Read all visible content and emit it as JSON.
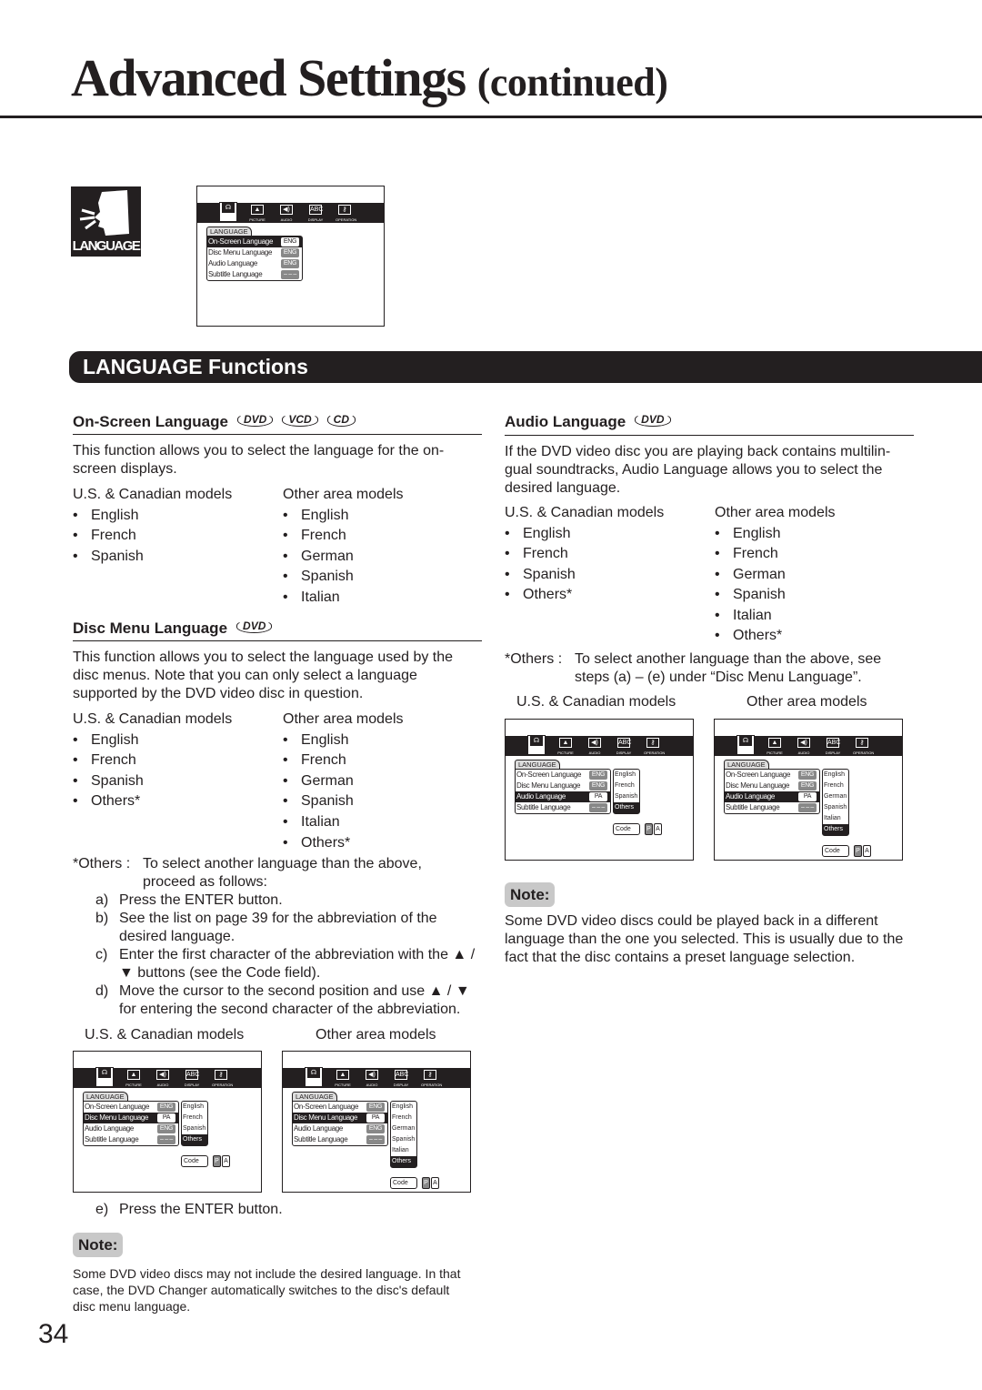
{
  "header": {
    "title": "Advanced Settings",
    "title_suffix": "(continued)"
  },
  "language_icon": {
    "label": "LANGUAGE",
    "icon": "speaking-head-icon"
  },
  "banner": "LANGUAGE Functions",
  "page_number": "34",
  "menu": {
    "icons": [
      {
        "name": "language-icon",
        "label": ""
      },
      {
        "name": "picture-icon",
        "label": "PICTURE"
      },
      {
        "name": "audio-icon",
        "label": "AUDIO"
      },
      {
        "name": "display-icon",
        "label": "DISPLAY"
      },
      {
        "name": "operation-icon",
        "label": "OPERATION"
      }
    ],
    "tab": "LANGUAGE",
    "rows": [
      "On-Screen Language",
      "Disc Menu Language",
      "Audio Language",
      "Subtitle Language"
    ],
    "code_label": "Code",
    "code_chars": [
      "P",
      "A"
    ]
  },
  "mockups": {
    "top": {
      "selected": 0,
      "values": [
        "ENG",
        "ENG",
        "ENG",
        "– – –"
      ],
      "options": []
    },
    "disc_us": {
      "selected": 1,
      "values": [
        "ENG",
        "PA",
        "ENG",
        "– – –"
      ],
      "options": [
        "English",
        "French",
        "Spanish",
        "Others"
      ],
      "option_selected": 3
    },
    "disc_other": {
      "selected": 1,
      "values": [
        "ENG",
        "PA",
        "ENG",
        "– – –"
      ],
      "options": [
        "English",
        "French",
        "German",
        "Spanish",
        "Italian",
        "Others"
      ],
      "option_selected": 5
    },
    "audio_us": {
      "selected": 2,
      "values": [
        "ENG",
        "ENG",
        "PA",
        "– – –"
      ],
      "options": [
        "English",
        "French",
        "Spanish",
        "Others"
      ],
      "option_selected": 3
    },
    "audio_other": {
      "selected": 2,
      "values": [
        "ENG",
        "ENG",
        "PA",
        "– – –"
      ],
      "options": [
        "English",
        "French",
        "German",
        "Spanish",
        "Italian",
        "Others"
      ],
      "option_selected": 5
    }
  },
  "onscreen": {
    "heading": "On-Screen Language",
    "badges": [
      "DVD",
      "VCD",
      "CD"
    ],
    "para": [
      "This function allows you to select the language for the on-",
      "screen displays."
    ],
    "us_label": "U.S. & Canadian models",
    "other_label": "Other area models",
    "us": [
      "English",
      "French",
      "Spanish"
    ],
    "other": [
      "English",
      "French",
      "German",
      "Spanish",
      "Italian"
    ]
  },
  "discmenu": {
    "heading": "Disc Menu Language",
    "badges": [
      "DVD"
    ],
    "para": [
      "This function allows you to select the language used by the",
      "disc menus. Note that you can only select a language",
      "supported by the DVD video disc in question."
    ],
    "us_label": "U.S. & Canadian models",
    "other_label": "Other area models",
    "us": [
      "English",
      "French",
      "Spanish",
      "Others*"
    ],
    "other": [
      "English",
      "French",
      "German",
      "Spanish",
      "Italian",
      "Others*"
    ],
    "others_key": "*Others :",
    "others_text": [
      "To select another language than the above,",
      "proceed as follows:"
    ],
    "steps": [
      {
        "k": "a)",
        "lines": [
          "Press the ENTER button."
        ]
      },
      {
        "k": "b)",
        "lines": [
          "See the list on page 39 for the abbreviation of the",
          "desired language."
        ]
      },
      {
        "k": "c)",
        "lines": [
          "Enter the first character of the abbreviation with the ▲ /",
          "▼ buttons (see the Code field)."
        ]
      },
      {
        "k": "d)",
        "lines": [
          "Move the cursor to the second position and use ▲ / ▼",
          "for entering the second character of the abbreviation."
        ]
      }
    ],
    "step_e": {
      "k": "e)",
      "text": "Press the ENTER button."
    },
    "note_label": "Note:",
    "note": [
      "Some DVD video discs may not include the desired language. In that",
      "case, the DVD Changer automatically switches to the disc's default",
      "disc menu language."
    ]
  },
  "audio": {
    "heading": "Audio Language",
    "badges": [
      "DVD"
    ],
    "para": [
      "If the DVD video disc you are playing back contains multilin-",
      "gual soundtracks, Audio Language allows you to select the",
      "desired language."
    ],
    "us_label": "U.S. & Canadian models",
    "other_label": "Other area models",
    "us": [
      "English",
      "French",
      "Spanish",
      "Others*"
    ],
    "other": [
      "English",
      "French",
      "German",
      "Spanish",
      "Italian",
      "Others*"
    ],
    "others_key": "*Others :",
    "others_text": [
      "To select another language than the above, see",
      "steps (a) – (e) under “Disc Menu Language”."
    ],
    "note_label": "Note:",
    "note": [
      "Some DVD video discs could be played back in a different",
      "language than the one you selected. This is usually due to the",
      "fact that the disc contains a preset language selection."
    ]
  }
}
